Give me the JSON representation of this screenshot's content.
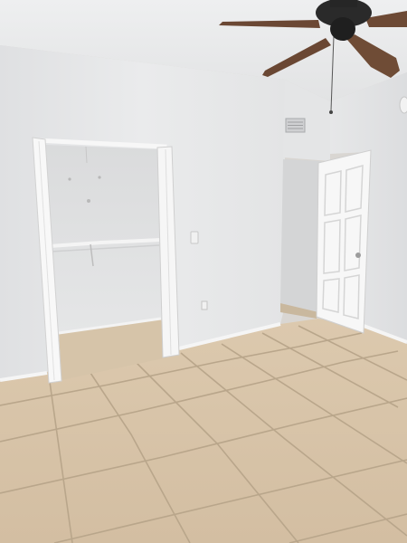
{
  "scene": {
    "description_tags": [
      "empty-bedroom",
      "open-closet",
      "ceiling-fan",
      "tile-floor",
      "open-interior-door"
    ],
    "colors": {
      "wall": "#e7e8e9",
      "wall_shadow": "#d9dadb",
      "ceiling": "#e9eaeb",
      "tile": "#d9c7ae",
      "grout": "#b6a389",
      "door": "#f6f6f6",
      "fan_blade": "#6e4b35",
      "fan_motor": "#2b2b2b"
    }
  }
}
